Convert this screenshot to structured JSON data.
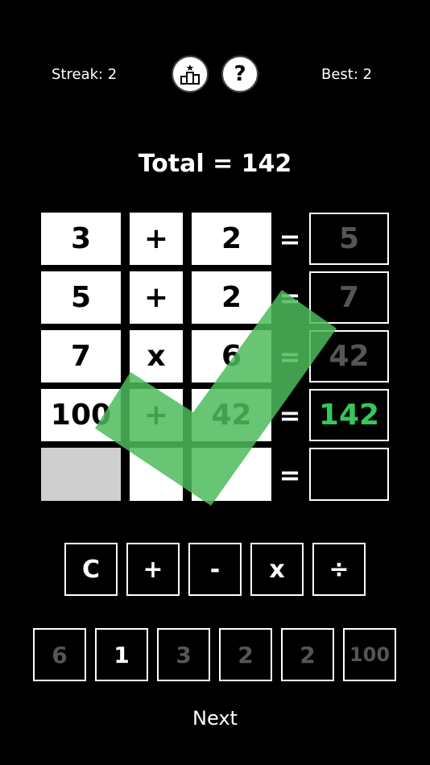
{
  "header": {
    "streak_label": "Streak: 2",
    "best_label": "Best: 2",
    "leaderboard_icon": "leaderboard-podium-icon",
    "help_icon": "question-mark-icon",
    "help_glyph": "?"
  },
  "title": "Total = 142",
  "rows": [
    {
      "a": "3",
      "op": "+",
      "b": "2",
      "eq": "=",
      "result": "5"
    },
    {
      "a": "5",
      "op": "+",
      "b": "2",
      "eq": "=",
      "result": "7"
    },
    {
      "a": "7",
      "op": "x",
      "b": "6",
      "eq": "=",
      "result": "42"
    },
    {
      "a": "100",
      "op": "+",
      "b": "42",
      "eq": "=",
      "result": "142"
    },
    {
      "a": "",
      "op": "",
      "b": "",
      "eq": "=",
      "result": ""
    }
  ],
  "operators": [
    "C",
    "+",
    "-",
    "x",
    "÷"
  ],
  "numbers": [
    {
      "value": "6",
      "used": true
    },
    {
      "value": "1",
      "used": false
    },
    {
      "value": "3",
      "used": true
    },
    {
      "value": "2",
      "used": true
    },
    {
      "value": "2",
      "used": true
    },
    {
      "value": "100",
      "used": true
    }
  ],
  "next_label": "Next",
  "colors": {
    "accent_green": "#34c759",
    "check_green": "#4cbb5c",
    "dim": "#555555"
  },
  "overlay_icon": "checkmark-icon"
}
